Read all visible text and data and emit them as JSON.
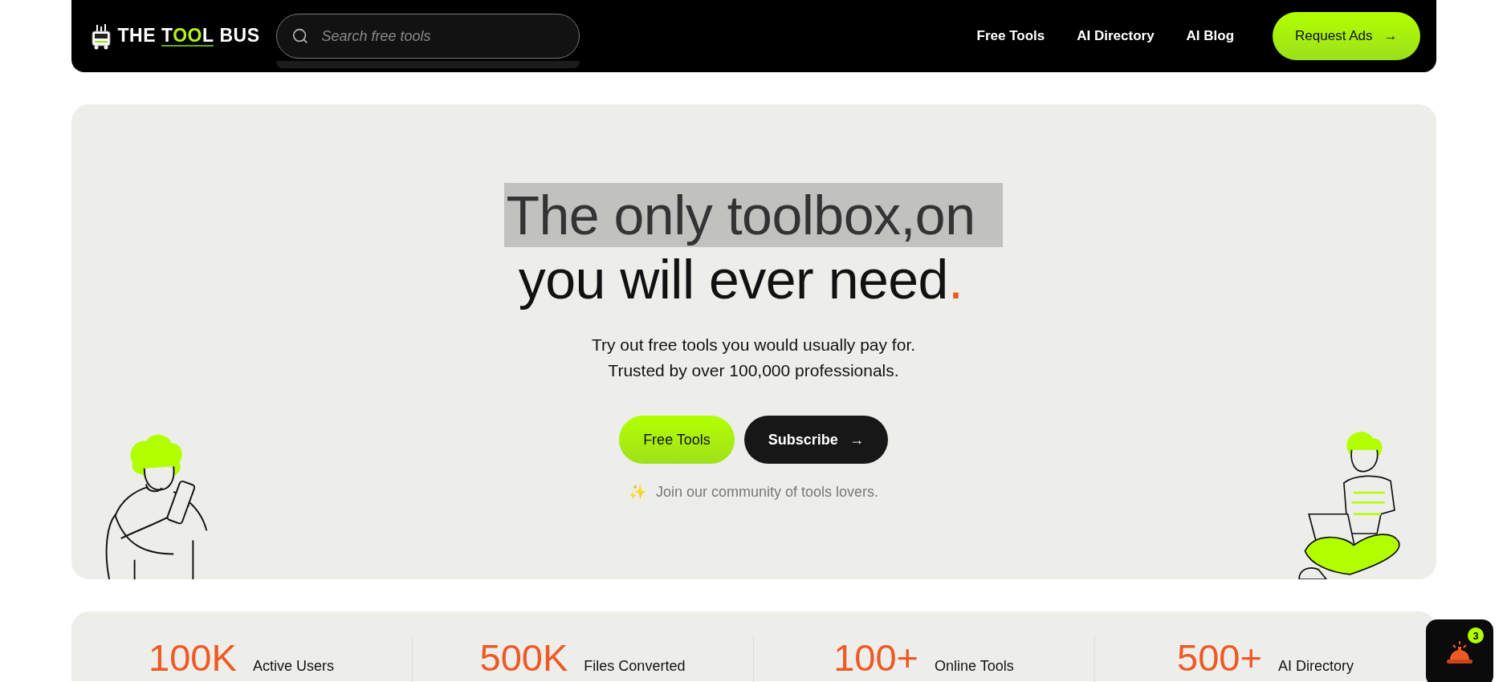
{
  "header": {
    "logo": [
      {
        "text": "THE",
        "accent": false
      },
      {
        "text": "TOOL",
        "accent": true
      },
      {
        "text": "BUS",
        "accent": false
      }
    ],
    "search": {
      "placeholder": "Search free tools"
    },
    "nav": [
      "Free Tools",
      "AI Directory",
      "AI Blog"
    ],
    "cta": {
      "label": "Request Ads",
      "arrow": "→"
    }
  },
  "hero": {
    "title": [
      {
        "text": "The only toolbox,on",
        "highlighted": true
      },
      {
        "text": "you will ever need.",
        "highlighted": false
      }
    ],
    "subtitle": [
      "Try out free tools you would usually pay for.",
      "Trusted by over 100,000 professionals."
    ],
    "buttons": [
      {
        "label": "Free Tools",
        "kind": "primary"
      },
      {
        "label": "Subscribe",
        "kind": "dark",
        "arrow": "→"
      }
    ],
    "note": {
      "icon": "✨",
      "text": "Join our community of tools lovers."
    }
  },
  "stats": [
    {
      "value": "100K",
      "label": "Active Users"
    },
    {
      "value": "500K",
      "label": "Files Converted"
    },
    {
      "value": "100+",
      "label": "Online Tools"
    },
    {
      "value": "500+",
      "label": "AI Directory"
    }
  ],
  "widget": {
    "badge": "3"
  }
}
